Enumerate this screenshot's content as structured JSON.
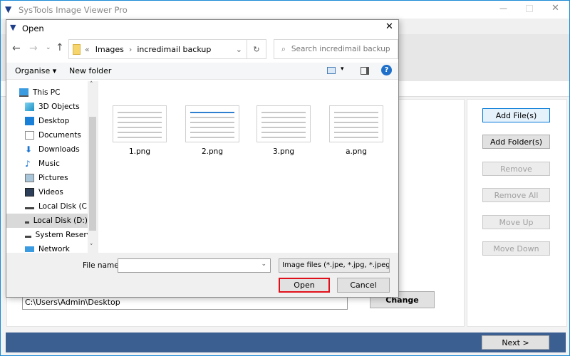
{
  "app": {
    "title": "SysTools Image Viewer Pro",
    "path_value": "C:\\Users\\Admin\\Desktop",
    "change_label": "Change",
    "next_label": "Next  >",
    "side_buttons": [
      {
        "label": "Add File(s)",
        "enabled": true
      },
      {
        "label": "Add Folder(s)",
        "enabled": true
      },
      {
        "label": "Remove",
        "enabled": false
      },
      {
        "label": "Remove All",
        "enabled": false
      },
      {
        "label": "Move Up",
        "enabled": false
      },
      {
        "label": "Move Down",
        "enabled": false
      }
    ],
    "colors": {
      "accent": "#1b8ad6",
      "footer": "#3b5f91",
      "open_highlight": "#e0101a"
    }
  },
  "dialog": {
    "title": "Open",
    "breadcrumb": [
      "Images",
      "incredimail backup"
    ],
    "search_placeholder": "Search incredimail backup",
    "toolbar": {
      "organise": "Organise",
      "new_folder": "New folder"
    },
    "nav": [
      {
        "label": "This PC",
        "icon": "pc-icon"
      },
      {
        "label": "3D Objects",
        "icon": "3d-objects-icon"
      },
      {
        "label": "Desktop",
        "icon": "desktop-icon"
      },
      {
        "label": "Documents",
        "icon": "documents-icon"
      },
      {
        "label": "Downloads",
        "icon": "downloads-icon"
      },
      {
        "label": "Music",
        "icon": "music-icon"
      },
      {
        "label": "Pictures",
        "icon": "pictures-icon"
      },
      {
        "label": "Videos",
        "icon": "videos-icon"
      },
      {
        "label": "Local Disk (C:)",
        "icon": "drive-icon"
      },
      {
        "label": "Local Disk (D:)",
        "icon": "drive-icon",
        "selected": true
      },
      {
        "label": "System Reserved",
        "icon": "drive-icon"
      },
      {
        "label": "Network",
        "icon": "network-icon"
      }
    ],
    "files": [
      "1.png",
      "2.png",
      "3.png",
      "a.png"
    ],
    "filename_label": "File name:",
    "filename_value": "",
    "filetype": "Image files (*.jpe, *.jpg, *.jpeg, *",
    "open_label": "Open",
    "cancel_label": "Cancel"
  }
}
